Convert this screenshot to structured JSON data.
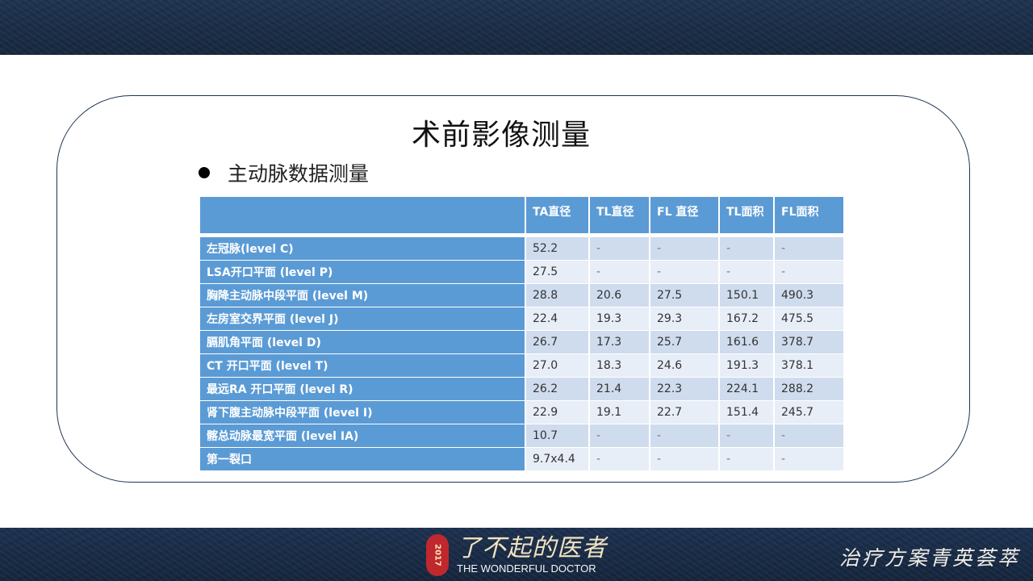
{
  "slide": {
    "title": "术前影像测量",
    "bullet": "主动脉数据测量"
  },
  "table": {
    "headers": [
      "",
      "TA直径",
      "TL直径",
      "FL 直径",
      "TL面积",
      "FL面积"
    ],
    "rows": [
      {
        "label": "左冠脉(level C)",
        "values": [
          "52.2",
          "-",
          "-",
          "-",
          "-"
        ]
      },
      {
        "label": "LSA开口平面  (level P)",
        "values": [
          "27.5",
          "-",
          "-",
          "-",
          "-"
        ]
      },
      {
        "label": "胸降主动脉中段平面 (level M)",
        "values": [
          "28.8",
          "20.6",
          "27.5",
          "150.1",
          "490.3"
        ]
      },
      {
        "label": "左房室交界平面  (level J)",
        "values": [
          "22.4",
          "19.3",
          "29.3",
          "167.2",
          "475.5"
        ]
      },
      {
        "label": "膈肌角平面 (level D)",
        "values": [
          "26.7",
          "17.3",
          "25.7",
          "161.6",
          "378.7"
        ]
      },
      {
        "label": "CT 开口平面 (level T)",
        "values": [
          "27.0",
          "18.3",
          "24.6",
          "191.3",
          "378.1"
        ]
      },
      {
        "label": "最远RA 开口平面 (level R)",
        "values": [
          "26.2",
          "21.4",
          "22.3",
          "224.1",
          "288.2"
        ]
      },
      {
        "label": "肾下腹主动脉中段平面 (level I)",
        "values": [
          "22.9",
          "19.1",
          "22.7",
          "151.4",
          "245.7"
        ]
      },
      {
        "label": "髂总动脉最宽平面 (level IA)",
        "values": [
          "10.7",
          "-",
          "-",
          "-",
          "-"
        ]
      },
      {
        "label": "第一裂口",
        "values": [
          "9.7x4.4",
          "-",
          "-",
          "-",
          "-"
        ]
      }
    ]
  },
  "footer": {
    "seal_text": "2017",
    "logo_cn": "了不起的医者",
    "logo_en": "THE WONDERFUL DOCTOR",
    "slogan": "治疗方案青英荟萃"
  },
  "colors": {
    "band": "#1b2e48",
    "header_blue": "#5b9bd5",
    "row_odd": "#cfdcee",
    "row_even": "#e8eef7"
  }
}
